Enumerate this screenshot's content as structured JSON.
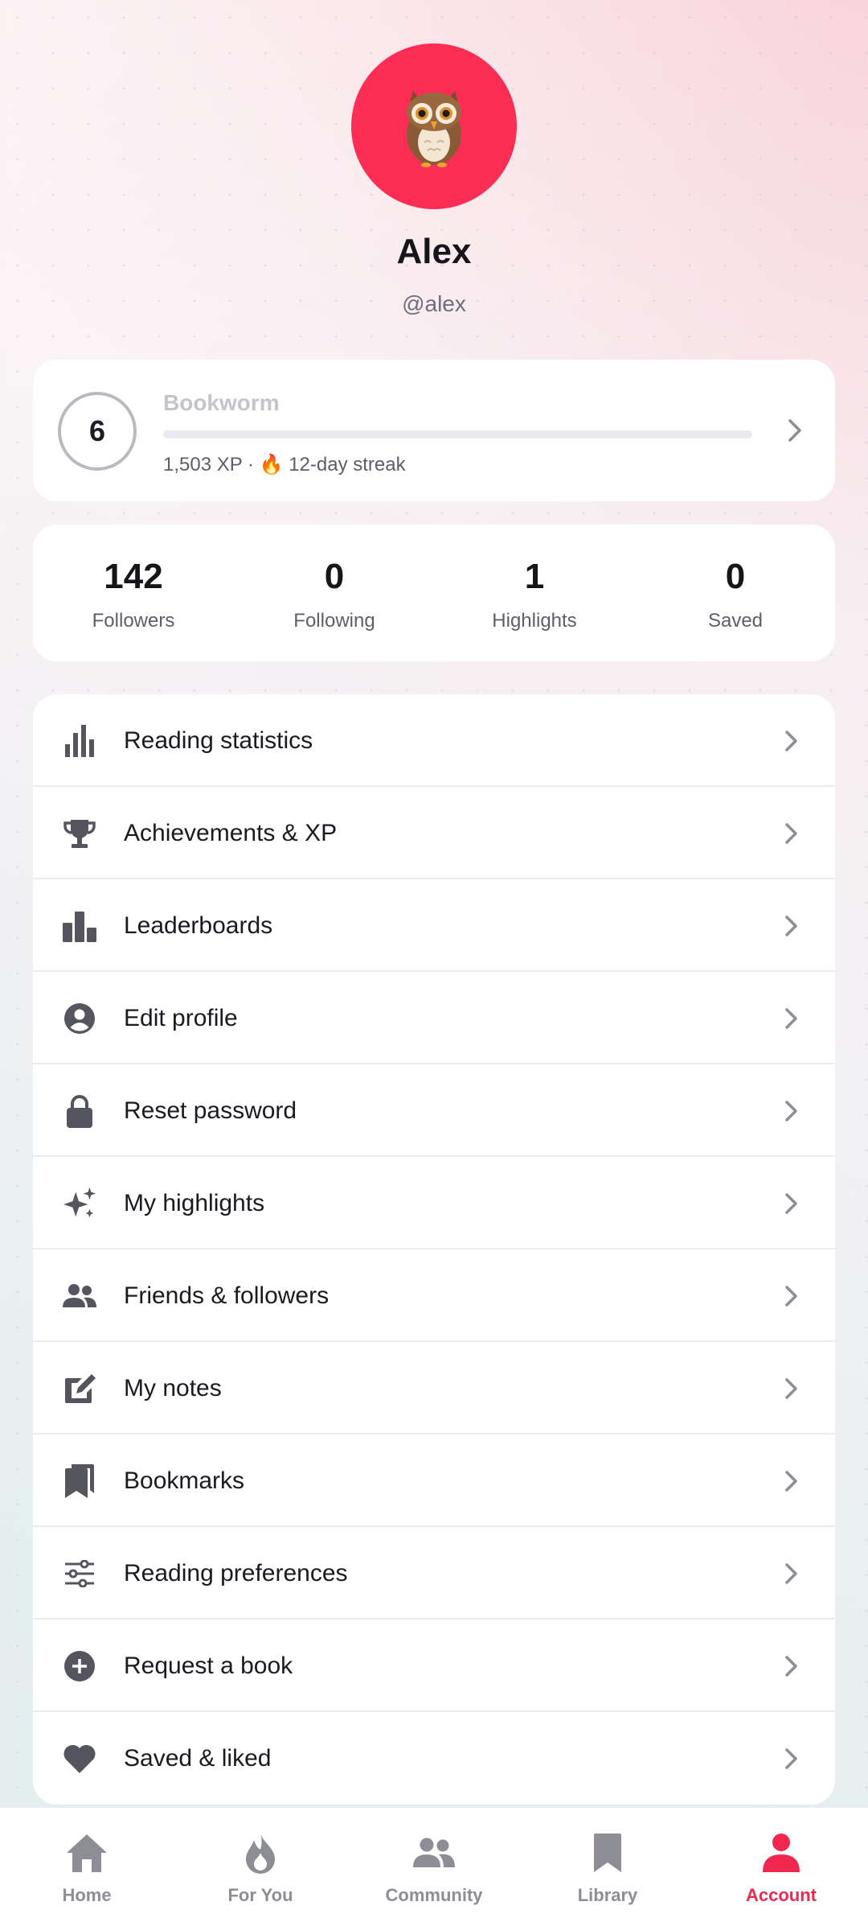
{
  "profile": {
    "name": "Alex",
    "handle": "@alex",
    "avatar_emoji": "🦉",
    "avatar_color": "#fb2d55"
  },
  "level": {
    "number": "6",
    "title": "Bookworm",
    "progress_fraction": 0.0,
    "subtitle": "1,503 XP · 🔥 12-day streak"
  },
  "stats": [
    {
      "value": "142",
      "label": "Followers"
    },
    {
      "value": "0",
      "label": "Following"
    },
    {
      "value": "1",
      "label": "Highlights"
    },
    {
      "value": "0",
      "label": "Saved"
    }
  ],
  "menu": [
    {
      "label": "Reading statistics",
      "icon": "bar-chart-icon"
    },
    {
      "label": "Achievements & XP",
      "icon": "trophy-icon"
    },
    {
      "label": "Leaderboards",
      "icon": "podium-icon"
    },
    {
      "label": "Edit profile",
      "icon": "account-circle-icon"
    },
    {
      "label": "Reset password",
      "icon": "lock-icon"
    },
    {
      "label": "My highlights",
      "icon": "sparkles-icon"
    },
    {
      "label": "Friends & followers",
      "icon": "people-icon"
    },
    {
      "label": "My notes",
      "icon": "edit-note-icon"
    },
    {
      "label": "Bookmarks",
      "icon": "bookmarks-icon"
    },
    {
      "label": "Reading preferences",
      "icon": "sliders-icon"
    },
    {
      "label": "Request a book",
      "icon": "add-circle-icon"
    },
    {
      "label": "Saved & liked",
      "icon": "heart-icon"
    }
  ],
  "tabs": [
    {
      "label": "Home",
      "icon": "home-icon",
      "active": false
    },
    {
      "label": "For You",
      "icon": "flame-icon",
      "active": false
    },
    {
      "label": "Community",
      "icon": "people-icon",
      "active": false
    },
    {
      "label": "Library",
      "icon": "bookmark-icon",
      "active": false
    },
    {
      "label": "Account",
      "icon": "person-icon",
      "active": true
    }
  ],
  "colors": {
    "accent": "#f0284f",
    "icon_gray": "#55555f",
    "tab_inactive": "#8d8d96"
  }
}
